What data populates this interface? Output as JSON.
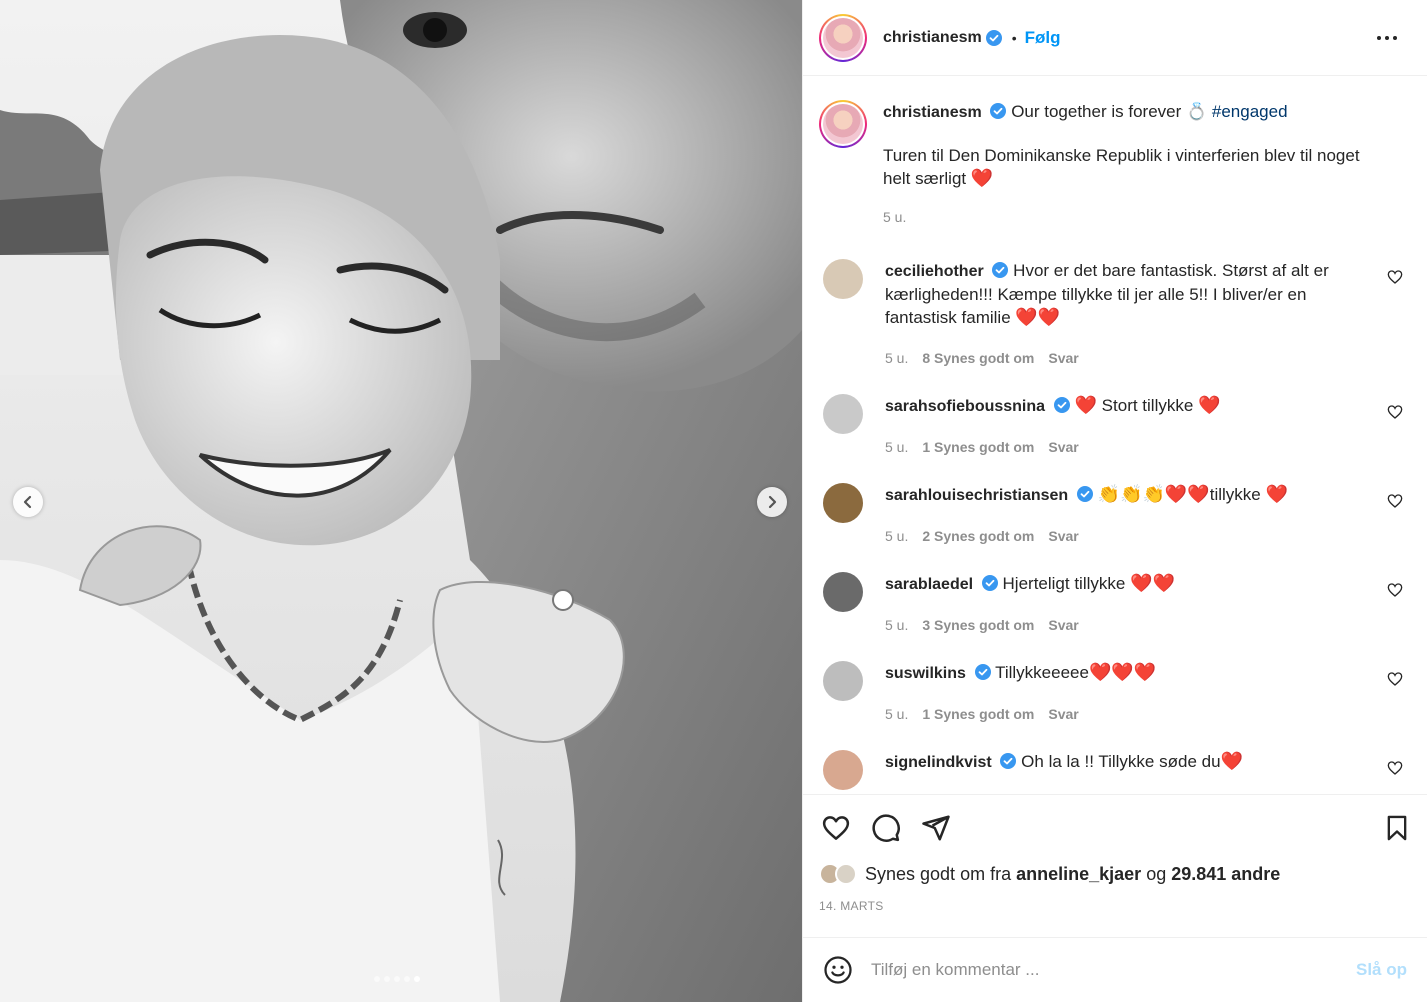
{
  "post": {
    "author": "christianesm",
    "follow_label": "Følg",
    "separator": "•",
    "caption_text": "Our together is forever 💍",
    "caption_hashtag": "#engaged",
    "caption_second": "Turen til Den Dominikanske Republik i vinterferien blev til noget helt særligt",
    "caption_time": "5 u."
  },
  "comments": [
    {
      "user": "ceciliehother",
      "text": "Hvor er det bare fantastisk. Størst af alt er kærligheden!!! Kæmpe tillykke til jer alle 5!! I bliver/er en fantastisk familie",
      "hearts": "❤️❤️",
      "time": "5 u.",
      "likes": "8 Synes godt om",
      "reply": "Svar",
      "avatar_color": "#d8c9b5"
    },
    {
      "user": "sarahsofieboussnina",
      "text_pre": "❤️",
      "text": "Stort tillykke",
      "hearts": "❤️",
      "time": "5 u.",
      "likes": "1 Synes godt om",
      "reply": "Svar",
      "avatar_color": "#c9c9c9"
    },
    {
      "user": "sarahlouisechristiansen",
      "text_pre": "👏👏👏❤️❤️",
      "text": "tillykke",
      "hearts": "❤️",
      "time": "5 u.",
      "likes": "2 Synes godt om",
      "reply": "Svar",
      "avatar_color": "#8b6a3e"
    },
    {
      "user": "sarablaedel",
      "text": "Hjerteligt tillykke",
      "hearts": "❤️❤️",
      "time": "5 u.",
      "likes": "3 Synes godt om",
      "reply": "Svar",
      "avatar_color": "#6a6a6a"
    },
    {
      "user": "suswilkins",
      "text": "Tillykkeeeee",
      "hearts": "❤️❤️❤️",
      "time": "5 u.",
      "likes": "1 Synes godt om",
      "reply": "Svar",
      "avatar_color": "#bdbdbd"
    },
    {
      "user": "signelindkvist",
      "text": "Oh la la !! Tillykke søde du",
      "hearts": "❤️",
      "avatar_color": "#d8a890"
    }
  ],
  "likes": {
    "prefix": "Synes godt om fra",
    "user": "anneline_kjaer",
    "conj": "og",
    "count": "29.841 andre"
  },
  "date": "14. MARTS",
  "add_comment": {
    "placeholder": "Tilføj en kommentar ...",
    "post_label": "Slå op"
  },
  "colors": {
    "link": "#0095f6",
    "hashtag": "#00376b",
    "muted": "#8e8e8e",
    "heart": "#e0102a"
  },
  "carousel": {
    "count": 5,
    "active": 5
  }
}
